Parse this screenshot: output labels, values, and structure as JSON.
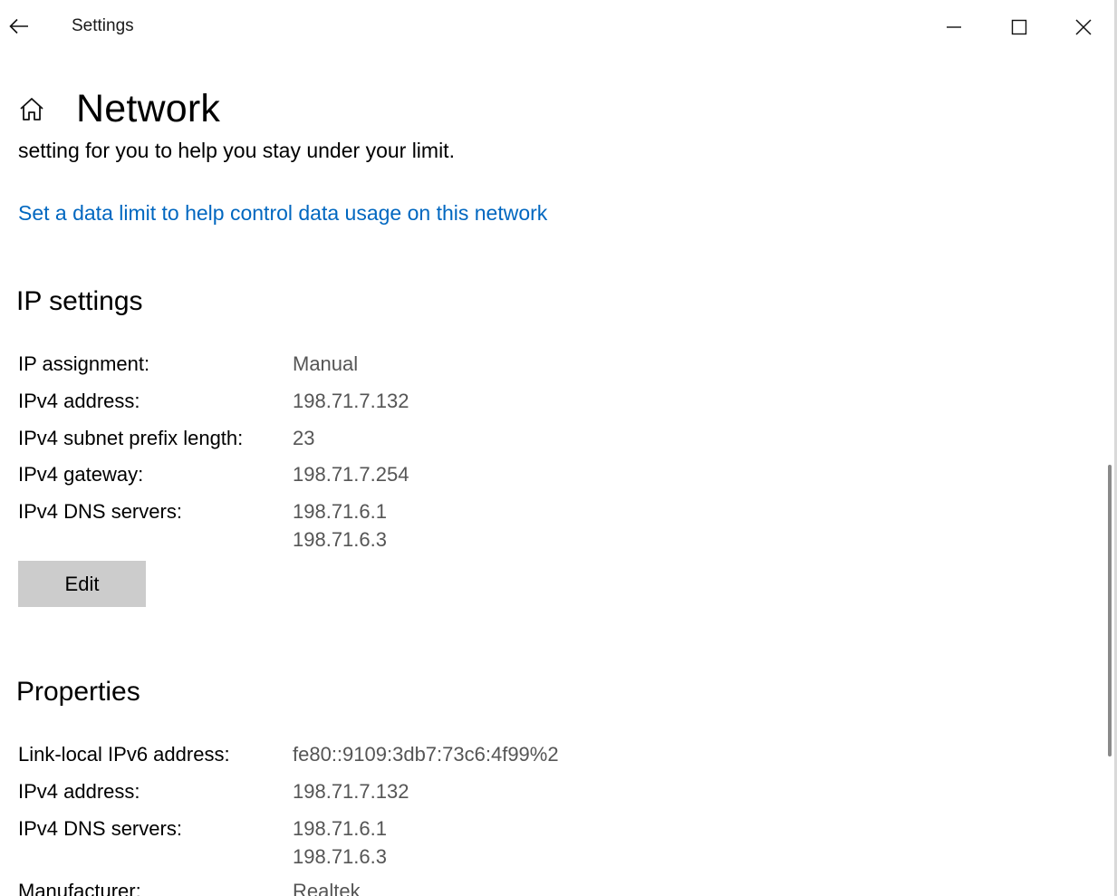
{
  "window": {
    "title": "Settings"
  },
  "header": {
    "title": "Network"
  },
  "data_usage": {
    "description_tail": "setting for you to help you stay under your limit.",
    "link_text": "Set a data limit to help control data usage on this network"
  },
  "ip_settings": {
    "title": "IP settings",
    "rows": [
      {
        "label": "IP assignment:",
        "values": [
          "Manual"
        ]
      },
      {
        "label": "IPv4 address:",
        "values": [
          "198.71.7.132"
        ]
      },
      {
        "label": "IPv4 subnet prefix length:",
        "values": [
          "23"
        ]
      },
      {
        "label": "IPv4 gateway:",
        "values": [
          "198.71.7.254"
        ]
      },
      {
        "label": "IPv4 DNS servers:",
        "values": [
          "198.71.6.1",
          "198.71.6.3"
        ]
      }
    ],
    "edit_label": "Edit"
  },
  "properties": {
    "title": "Properties",
    "rows": [
      {
        "label": "Link-local IPv6 address:",
        "values": [
          "fe80::9109:3db7:73c6:4f99%2"
        ]
      },
      {
        "label": "IPv4 address:",
        "values": [
          "198.71.7.132"
        ]
      },
      {
        "label": "IPv4 DNS servers:",
        "values": [
          "198.71.6.1",
          "198.71.6.3"
        ]
      },
      {
        "label": "Manufacturer:",
        "values": [
          "Realtek"
        ]
      }
    ]
  },
  "icons": {
    "back": "arrow-left-icon",
    "home": "home-icon",
    "minimize": "minimize-icon",
    "maximize": "maximize-icon",
    "close": "close-icon"
  },
  "colors": {
    "link": "#0067c0",
    "value_text": "#555555",
    "button_bg": "#cccccc"
  }
}
